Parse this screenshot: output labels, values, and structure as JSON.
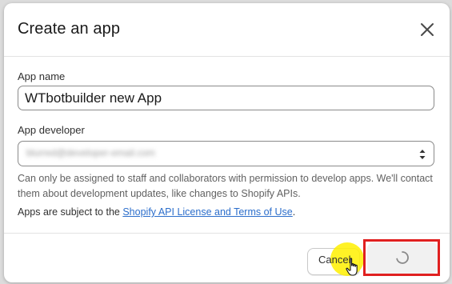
{
  "modal": {
    "title": "Create an app",
    "close_icon": "close-icon"
  },
  "form": {
    "app_name_label": "App name",
    "app_name_value": "WTbotbuilder new App",
    "app_developer_label": "App developer",
    "app_developer_value": "blurred@developer-email.com",
    "help_text": "Can only be assigned to staff and collaborators with permission to develop apps. We'll contact them about development updates, like changes to Shopify APIs.",
    "terms_prefix": "Apps are subject to the ",
    "terms_link": "Shopify API License and Terms of Use",
    "terms_suffix": "."
  },
  "footer": {
    "cancel_label": "Cancel",
    "create_button_state": "loading"
  },
  "colors": {
    "link": "#2c6ecb",
    "annotation": "#e02020",
    "click_highlight": "#fff000"
  }
}
